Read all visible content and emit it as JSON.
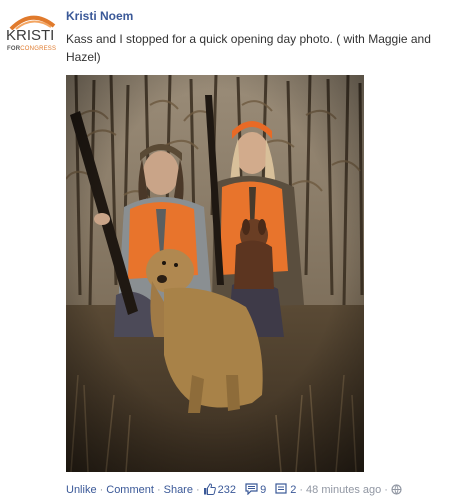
{
  "post": {
    "logo": {
      "icon": "kristi-for-congress-logo",
      "word": "KRISTI",
      "sub_prefix": "FOR",
      "sub_suffix": "CONGRESS"
    },
    "author": "Kristi Noem",
    "message": "Kass and I stopped for a quick opening day photo. ( with Maggie and Hazel)",
    "photo": {
      "icon": "photo-two-women-hunting-with-dogs"
    }
  },
  "footer": {
    "unlike_label": "Unlike",
    "comment_label": "Comment",
    "share_label": "Share",
    "likes_icon": "thumbs-up-icon",
    "likes_count": "232",
    "comments_icon": "comment-bubble-icon",
    "comments_count": "9",
    "shares_icon": "share-icon",
    "shares_count": "2",
    "timestamp": "48 minutes ago",
    "privacy_icon": "globe-icon"
  },
  "colors": {
    "link": "#3b5998",
    "meta": "#9197a3",
    "logo_orange": "#e07a2c"
  }
}
